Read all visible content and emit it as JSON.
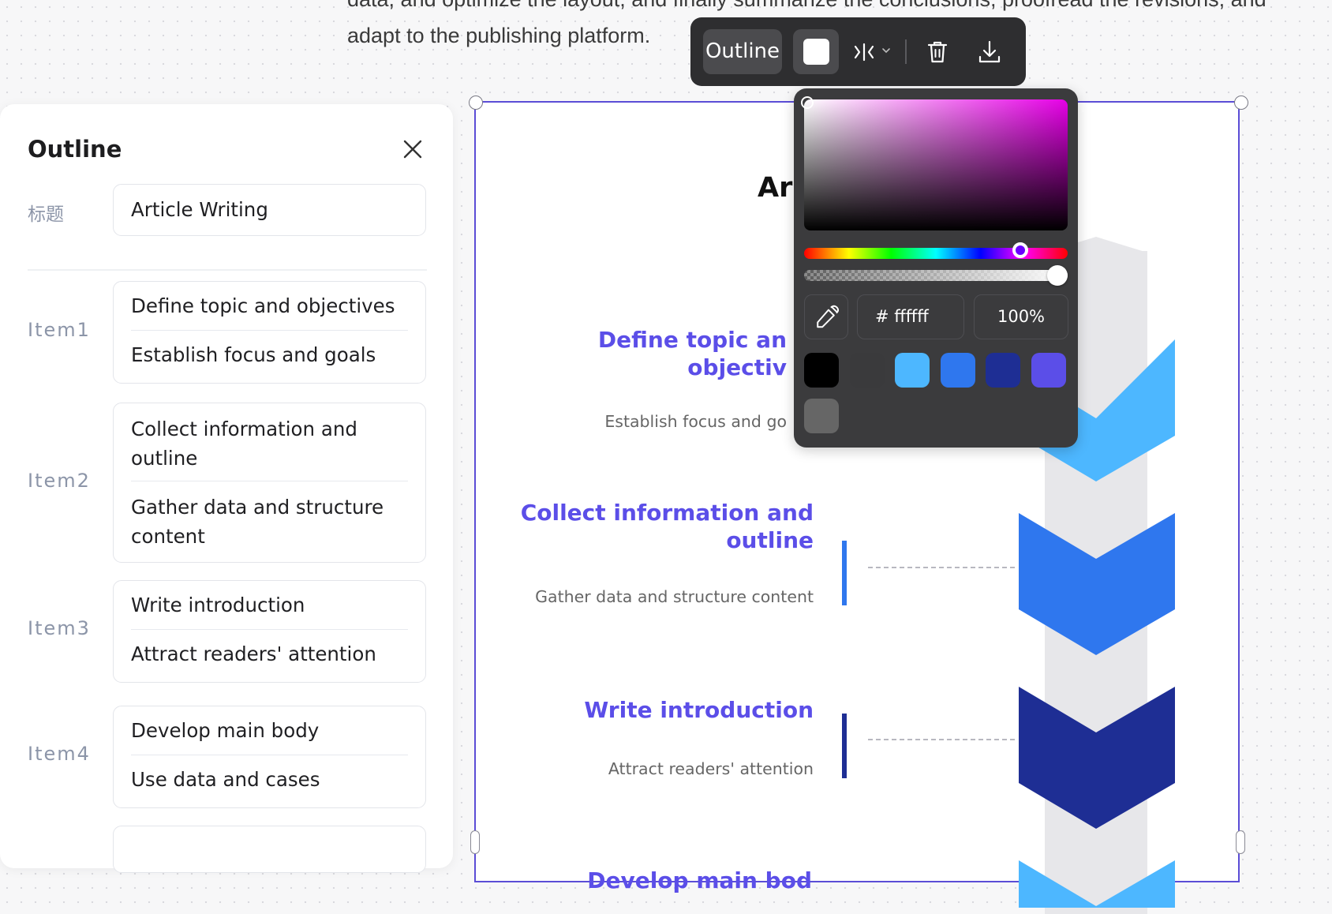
{
  "document": {
    "line1": "data, and optimize the layout, and finally summarize the conclusions, proofread the revisions, and",
    "line2": "adapt to the publishing platform."
  },
  "outline_panel": {
    "title": "Outline",
    "title_field_label": "标题",
    "title_field_value": "Article Writing",
    "items": [
      {
        "label": "Item1",
        "heading": "Define topic and objectives",
        "subheading": "Establish focus and goals"
      },
      {
        "label": "Item2",
        "heading": [
          "Collect information and",
          "outline"
        ],
        "subheading": [
          "Gather data and structure",
          "content"
        ]
      },
      {
        "label": "Item3",
        "heading": "Write introduction",
        "subheading": "Attract readers' attention"
      },
      {
        "label": "Item4",
        "heading": "Develop main body",
        "subheading": "Use data and cases"
      }
    ]
  },
  "toolbar": {
    "outline_label": "Outline",
    "icons": [
      "color-swatch-icon",
      "layout-flip-icon",
      "chevron-down-icon",
      "trash-icon",
      "download-icon"
    ]
  },
  "color_picker": {
    "hex_value": "# ffffff",
    "opacity": "100%",
    "hue_fraction": 0.82,
    "alpha_fraction": 1.0,
    "swatches": [
      "#000000",
      "#3a3a3c",
      "#4db7ff",
      "#2f77ee",
      "#1e2e94",
      "#5b4ee8",
      "#666666"
    ]
  },
  "infographic": {
    "title": "Ar",
    "steps": [
      {
        "title": [
          "Define topic an",
          "objectiv"
        ],
        "subtitle": "Establish focus and go",
        "color": "#4db7ff"
      },
      {
        "title": [
          "Collect information and",
          "outline"
        ],
        "subtitle": "Gather data and structure content",
        "color": "#2f77ee"
      },
      {
        "title": [
          "Write introduction"
        ],
        "subtitle": "Attract readers' attention",
        "color": "#1e2e94"
      },
      {
        "title": [
          "Develop main bod"
        ],
        "subtitle": "",
        "color": "#4db7ff"
      }
    ],
    "colors": {
      "title_text": "#5b4ee8",
      "selection": "#5b4dd6"
    }
  }
}
